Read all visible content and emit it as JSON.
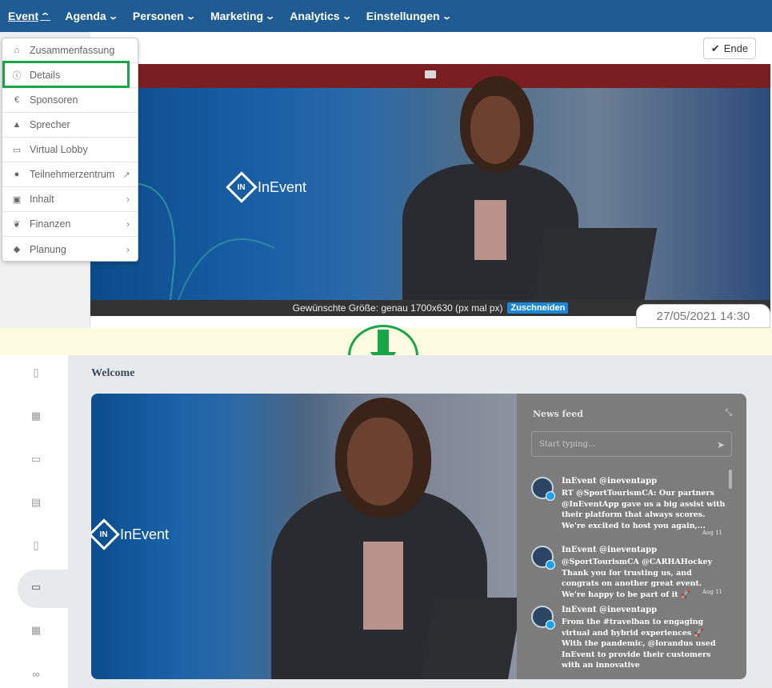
{
  "top": {
    "nav": [
      {
        "label": "Event"
      },
      {
        "label": "Agenda"
      },
      {
        "label": "Personen"
      },
      {
        "label": "Marketing"
      },
      {
        "label": "Analytics"
      },
      {
        "label": "Einstellungen"
      }
    ],
    "end_button": "Ende",
    "dropdown": [
      {
        "label": "Zusammenfassung",
        "icon": "home-icon"
      },
      {
        "label": "Details",
        "icon": "info-icon"
      },
      {
        "label": "Sponsoren",
        "icon": "euro-icon"
      },
      {
        "label": "Sprecher",
        "icon": "graduation-cap-icon"
      },
      {
        "label": "Virtual Lobby",
        "icon": "tv-icon"
      },
      {
        "label": "Teilnehmerzentrum",
        "icon": "user-circle-icon"
      },
      {
        "label": "Inhalt",
        "icon": "images-icon"
      },
      {
        "label": "Finanzen",
        "icon": "leaf-icon"
      },
      {
        "label": "Planung",
        "icon": "diamond-icon"
      }
    ],
    "banner_caption": "Gewünschte Größe: genau 1700x630 (px mal px)",
    "crop_button": "Zuschneiden",
    "date": "27/05/2021 14:30",
    "logo_text": "InEvent"
  },
  "lobby": {
    "welcome": "Welcome",
    "logo_text": "InEvent",
    "feed": {
      "title": "News feed",
      "input_placeholder": "Start typing...",
      "posts": [
        {
          "author": "InEvent @ineventapp",
          "text": "RT @SportTourismCA: Our partners @InEventApp gave us a big assist with their platform that always scores. We're excited to host you again,...",
          "date": "Aug 11"
        },
        {
          "author": "InEvent @ineventapp",
          "text": "@SportTourismCA @CARHAHockey Thank you for trusting us, and congrats on another great event. We're happy to be part of it 🚀",
          "date": "Aug 11"
        },
        {
          "author": "InEvent @ineventapp",
          "text": "From the #travelban to engaging virtual and hybrid experiences 🚀 With the pandemic, @lorandus used InEvent to provide their customers with an innovative",
          "date": ""
        }
      ]
    }
  },
  "colors": {
    "nav_bg": "#1f5c93",
    "highlight": "#1aa54a",
    "crop": "#1a88d6"
  }
}
